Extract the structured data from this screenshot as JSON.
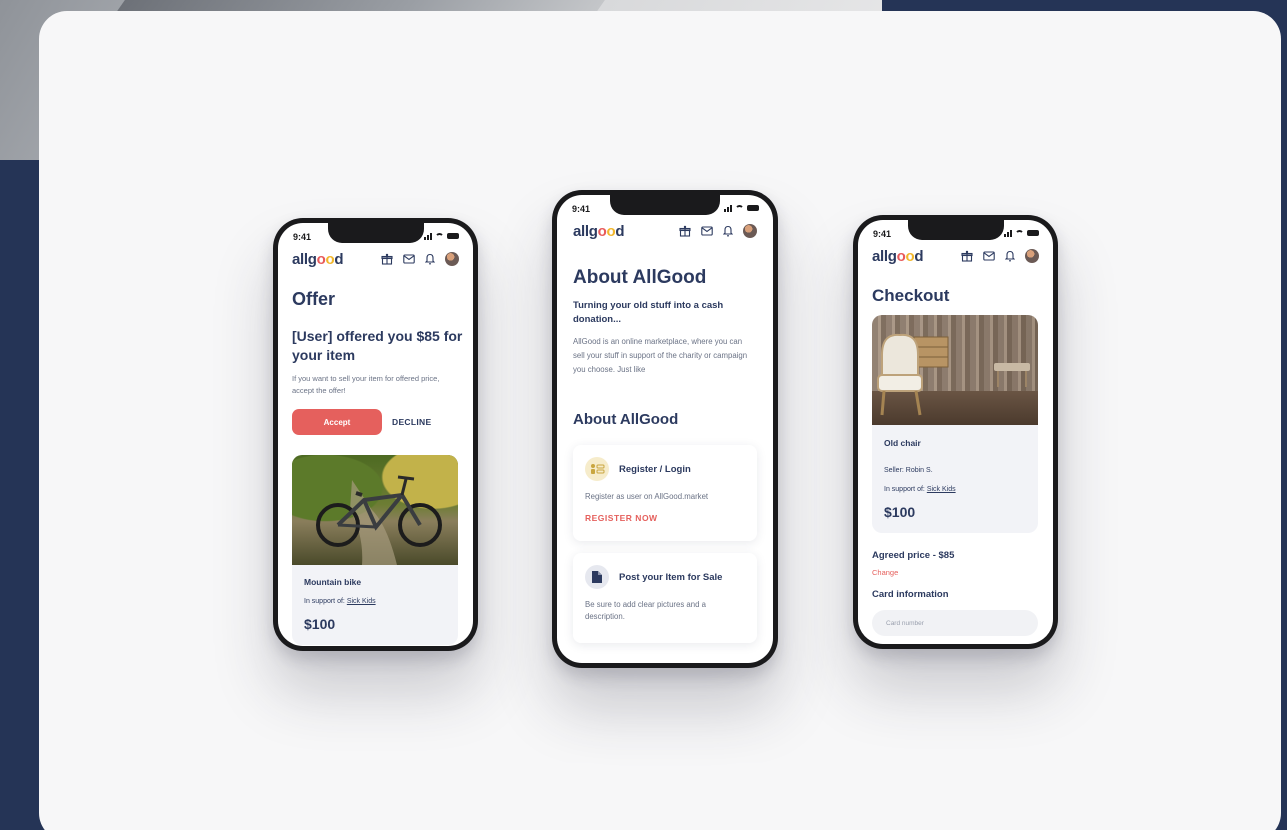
{
  "colors": {
    "page_background": "#253456",
    "card_background": "#f7f7f8",
    "brand_navy": "#2c3a5f",
    "accent_red": "#e5605d",
    "logo_yellow": "#f2b72c",
    "muted_text": "#6b7386"
  },
  "status_bar": {
    "time": "9:41"
  },
  "app": {
    "logo": {
      "part1": "allg",
      "o1": "o",
      "o2": "o",
      "part2": "d"
    },
    "nav_icons": [
      "gift-icon",
      "mail-icon",
      "bell-icon",
      "avatar"
    ]
  },
  "offer_screen": {
    "title": "Offer",
    "headline": "[User] offered you $85 for your item",
    "description": "If you want to sell your item for offered price, accept the offer!",
    "accept_label": "Accept",
    "decline_label": "DECLINE",
    "item": {
      "name": "Mountain bike",
      "support_prefix": "In support of:",
      "support_cause": "Sick Kids",
      "price": "$100"
    }
  },
  "about_screen": {
    "title": "About AllGood",
    "tagline": "Turning your old stuff into a cash donation...",
    "description": "AllGood is an online marketplace, where you can sell your stuff in support of the charity or campaign you choose.  Just like",
    "section_title": "About AllGood",
    "cards": [
      {
        "icon": "register-icon",
        "title": "Register / Login",
        "description": "Register as user on AllGood.market",
        "link": "REGISTER NOW"
      },
      {
        "icon": "post-item-icon",
        "title": "Post your Item for Sale",
        "description": "Be sure to add clear pictures and a description."
      }
    ]
  },
  "checkout_screen": {
    "title": "Checkout",
    "item": {
      "name": "Old chair",
      "seller": "Seller: Robin S.",
      "support_prefix": "In support of:",
      "support_cause": "Sick Kids",
      "price": "$100"
    },
    "agreed_price": "Agreed price - $85",
    "change_label": "Change",
    "card_info_label": "Card information",
    "card_number_placeholder": "Card number"
  }
}
